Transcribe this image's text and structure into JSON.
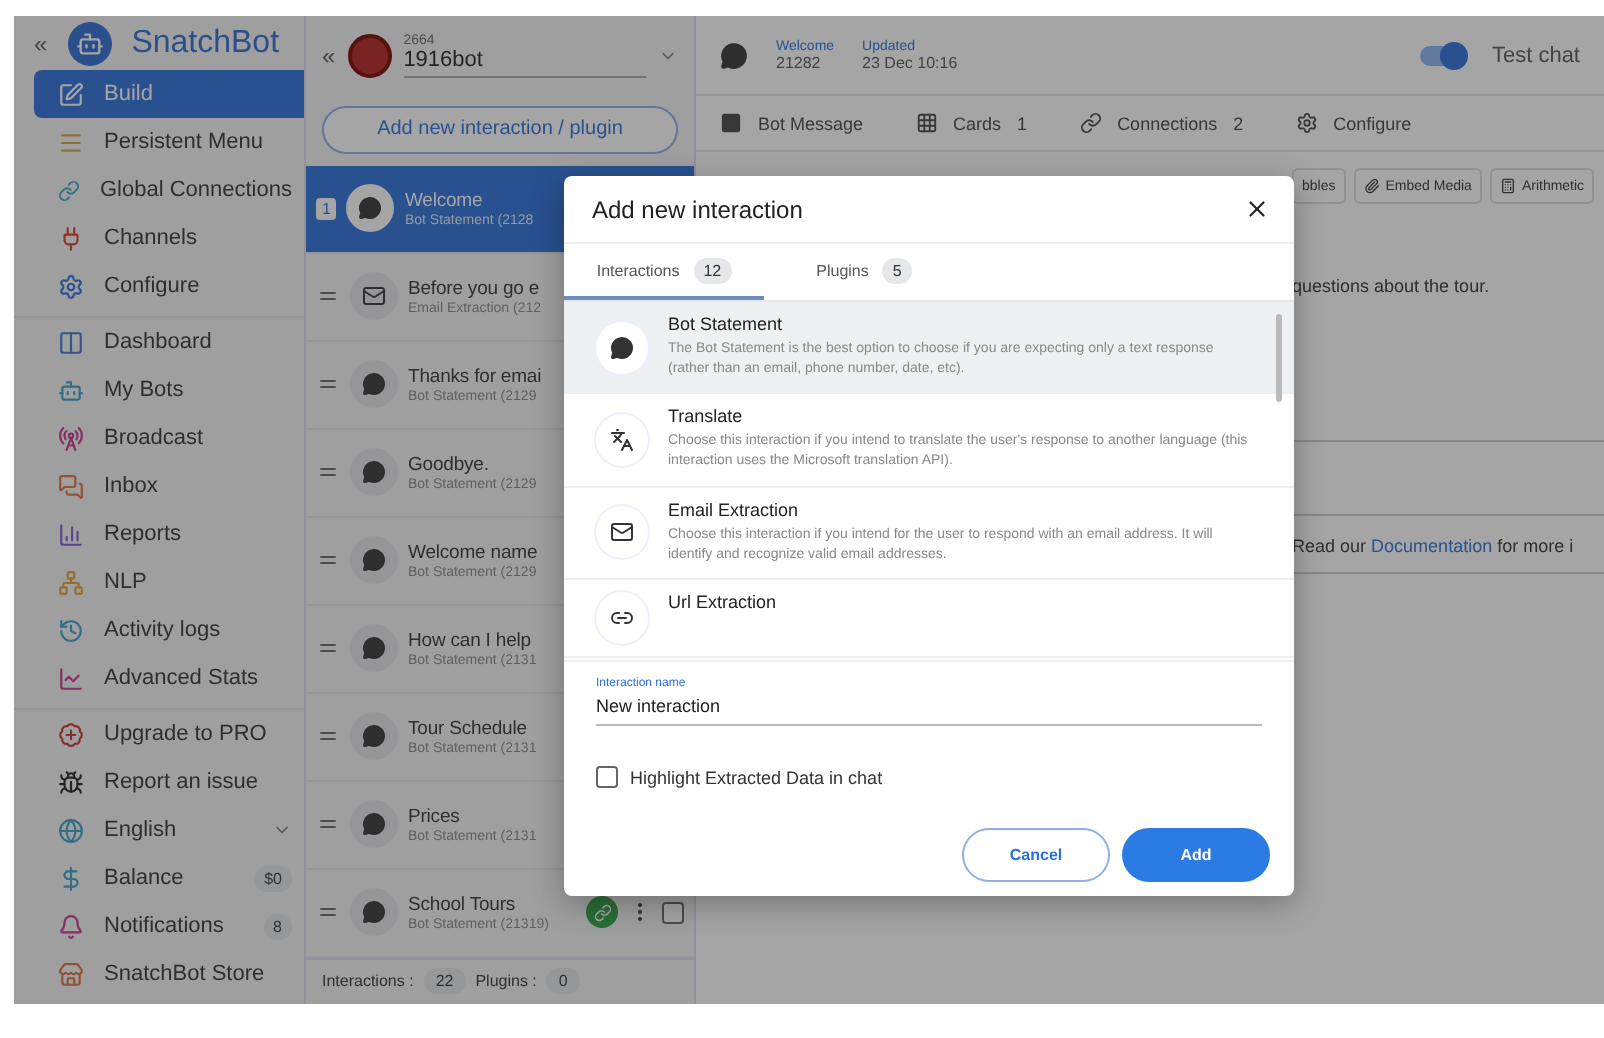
{
  "sidebar": {
    "collapse": "«",
    "brand": "SnatchBot",
    "groups": [
      {
        "items": [
          {
            "label": "Build",
            "selected": true,
            "kind": "plain"
          },
          {
            "label": "Persistent Menu",
            "selected": false,
            "kind": "plain"
          },
          {
            "label": "Global Connections",
            "selected": false,
            "kind": "plain"
          },
          {
            "label": "Channels",
            "selected": false,
            "kind": "plain"
          },
          {
            "label": "Configure",
            "selected": false,
            "kind": "plain"
          }
        ]
      },
      {
        "items": [
          {
            "label": "Dashboard",
            "selected": false,
            "kind": "plain"
          },
          {
            "label": "My Bots",
            "selected": false,
            "kind": "plain"
          },
          {
            "label": "Broadcast",
            "selected": false,
            "kind": "plain"
          },
          {
            "label": "Inbox",
            "selected": false,
            "kind": "plain"
          },
          {
            "label": "Reports",
            "selected": false,
            "kind": "plain"
          },
          {
            "label": "NLP",
            "selected": false,
            "kind": "plain"
          },
          {
            "label": "Activity logs",
            "selected": false,
            "kind": "plain"
          },
          {
            "label": "Advanced Stats",
            "selected": false,
            "kind": "plain"
          }
        ]
      },
      {
        "items": [
          {
            "label": "Upgrade to PRO",
            "selected": false,
            "kind": "plain"
          },
          {
            "label": "Report an issue",
            "selected": false,
            "kind": "plain"
          },
          {
            "label": "English",
            "selected": false,
            "kind": "dropdown"
          },
          {
            "label": "Balance",
            "selected": false,
            "kind": "badge",
            "badge": "$0"
          },
          {
            "label": "Notifications",
            "selected": false,
            "kind": "badge",
            "badge": "8"
          },
          {
            "label": "SnatchBot Store",
            "selected": false,
            "kind": "plain"
          }
        ]
      }
    ]
  },
  "bot_selector": {
    "collapse": "«",
    "id": "2664",
    "name": "1916bot"
  },
  "add_button": "Add new interaction / plugin",
  "interactions": [
    {
      "title": "Welcome",
      "subtitle": "Bot Statement (2128",
      "kind": "message",
      "selected": true,
      "badge": "1"
    },
    {
      "title": "Before you go e",
      "subtitle": "Email Extraction (212",
      "kind": "email",
      "selected": false
    },
    {
      "title": "Thanks for emai",
      "subtitle": "Bot Statement (2129",
      "kind": "message",
      "selected": false
    },
    {
      "title": "Goodbye.",
      "subtitle": "Bot Statement (2129",
      "kind": "message",
      "selected": false
    },
    {
      "title": "Welcome name",
      "subtitle": "Bot Statement (2129",
      "kind": "message",
      "selected": false
    },
    {
      "title": "How can I help",
      "subtitle": "Bot Statement (2131",
      "kind": "message",
      "selected": false
    },
    {
      "title": "Tour Schedule",
      "subtitle": "Bot Statement (2131",
      "kind": "message",
      "selected": false
    },
    {
      "title": "Prices",
      "subtitle": "Bot Statement (2131",
      "kind": "message",
      "selected": false
    },
    {
      "title": "School Tours",
      "subtitle": "Bot Statement (21319)",
      "kind": "message",
      "selected": false,
      "show_actions": true
    }
  ],
  "footer": {
    "interactions_label": "Interactions :",
    "interactions_count": "22",
    "plugins_label": "Plugins :",
    "plugins_count": "0"
  },
  "header": {
    "name_label": "Welcome",
    "id": "21282",
    "updated_label": "Updated",
    "updated": "23 Dec 10:16",
    "test_chat": {
      "label": "Test chat",
      "on": true
    }
  },
  "tabs": [
    {
      "label": "Bot Message"
    },
    {
      "label": "Cards",
      "count": "1"
    },
    {
      "label": "Connections",
      "count": "2"
    },
    {
      "label": "Configure"
    }
  ],
  "toolbar": [
    "bbles",
    "Embed Media",
    "Arithmetic"
  ],
  "body_text": "questions about the tour.",
  "doc_note": {
    "before": "Read our",
    "link": "Documentation",
    "after": "for more i"
  },
  "modal": {
    "title": "Add new interaction",
    "tabs": [
      {
        "label": "Interactions",
        "count": "12",
        "selected": true
      },
      {
        "label": "Plugins",
        "count": "5",
        "selected": false
      }
    ],
    "options": [
      {
        "kind": "message",
        "title": "Bot Statement",
        "description": "The Bot Statement is the best option to choose if you are expecting only a text response (rather than an email, phone number, date, etc).",
        "selected": true
      },
      {
        "kind": "translate",
        "title": "Translate",
        "description": "Choose this interaction if you intend to translate the user's response to another language (this interaction uses the Microsoft translation API).",
        "selected": false
      },
      {
        "kind": "email",
        "title": "Email Extraction",
        "description": "Choose this interaction if you intend for the user to respond with an email address. It will identify and recognize valid email addresses.",
        "selected": false
      },
      {
        "kind": "url",
        "title": "Url Extraction",
        "selected": false
      }
    ],
    "field": {
      "label": "Interaction name",
      "value": "New interaction"
    },
    "checkbox": {
      "label": "Highlight Extracted Data in chat",
      "checked": false
    },
    "cancel": "Cancel",
    "add": "Add"
  }
}
